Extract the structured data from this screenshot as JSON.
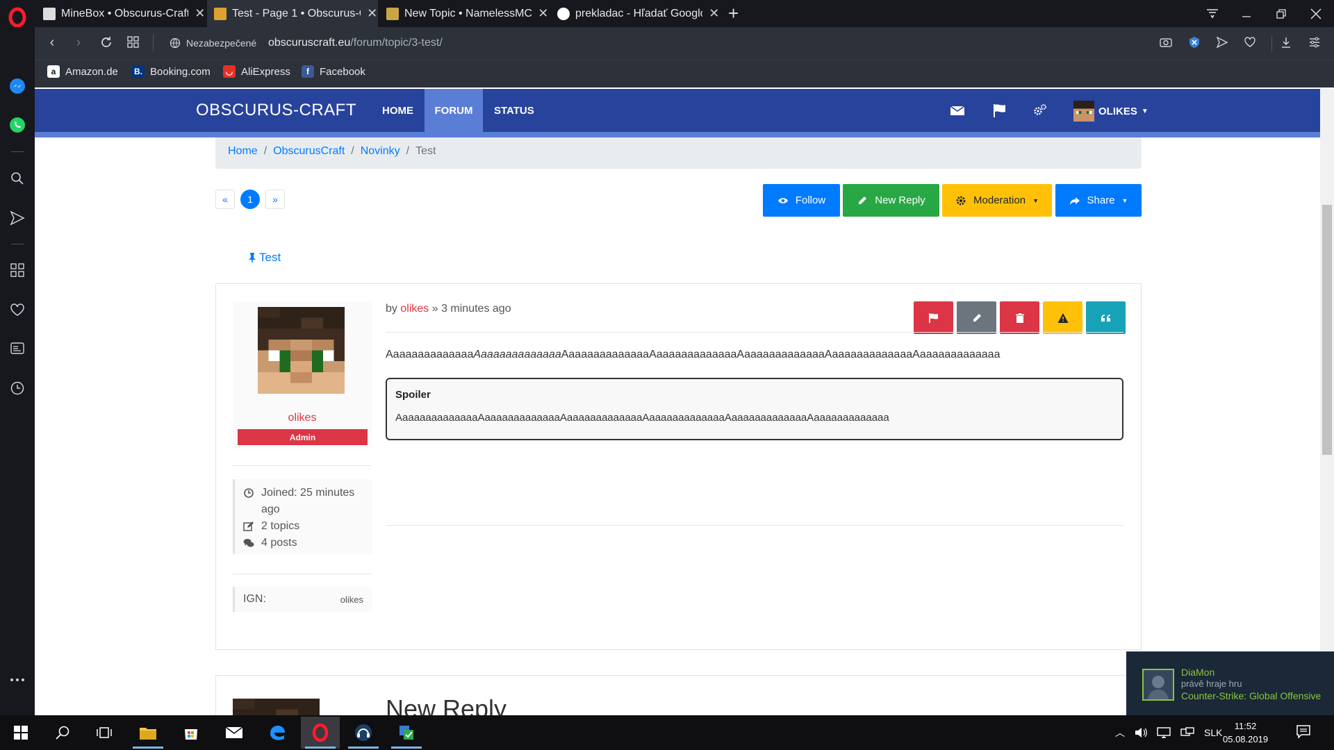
{
  "browser": {
    "tabs": [
      {
        "title": "MineBox • Obscurus-Craft",
        "active": false
      },
      {
        "title": "Test - Page 1 • Obscurus-Craft",
        "active": true
      },
      {
        "title": "New Topic • NamelessMC",
        "active": false
      },
      {
        "title": "prekladac - Hľadať Googlom",
        "active": false
      }
    ],
    "security_label": "Nezabezpečené",
    "url_host": "obscuruscraft.eu",
    "url_path": "/forum/topic/3-test/",
    "bookmarks": [
      {
        "label": "Amazon.de"
      },
      {
        "label": "Booking.com"
      },
      {
        "label": "AliExpress"
      },
      {
        "label": "Facebook"
      }
    ]
  },
  "site": {
    "brand": "OBSCURUS-CRAFT",
    "nav": {
      "home": "HOME",
      "forum": "FORUM",
      "status": "STATUS"
    },
    "user_menu": "OLIKES"
  },
  "breadcrumb": {
    "home": "Home",
    "section": "ObscurusCraft",
    "category": "Novinky",
    "current": "Test"
  },
  "pagination": {
    "prev": "«",
    "current": "1",
    "next": "»"
  },
  "actions": {
    "follow": "Follow",
    "new_reply": "New Reply",
    "moderation": "Moderation",
    "share": "Share"
  },
  "topic": {
    "title": "Test"
  },
  "post": {
    "by": "by",
    "author": "olikes",
    "separator": "»",
    "time": "3 minutes ago",
    "content_a": "Aaaaaaaaaaaaaa",
    "content_b_italic": "Aaaaaaaaaaaaaa",
    "content_c": "AaaaaaaaaaaaaaAaaaaaaaaaaaaaAaaaaaaaaaaaaaAaaaaaaaaaaaaaAaaaaaaaaaaaaa",
    "spoiler_title": "Spoiler",
    "spoiler_body": "AaaaaaaaaaaaaaAaaaaaaaaaaaaaAaaaaaaaaaaaaaAaaaaaaaaaaaaaAaaaaaaaaaaaaaAaaaaaaaaaaaaa"
  },
  "user": {
    "name": "olikes",
    "role": "Admin",
    "joined": "Joined: 25 minutes ago",
    "topics": "2 topics",
    "posts": "4 posts",
    "ign_label": "IGN:",
    "ign_value": "olikes"
  },
  "reply": {
    "title": "New Reply"
  },
  "notification": {
    "name": "DiaMon",
    "action": "právě hraje hru",
    "game": "Counter-Strike: Global Offensive"
  },
  "taskbar": {
    "language": "SLK",
    "time": "11:52",
    "date": "05.08.2019"
  },
  "colors": {
    "navbar": "#28439c",
    "navbar_active": "#5a7ed6",
    "follow": "#007bff",
    "new_reply": "#28a745",
    "moderation": "#ffc107",
    "share": "#007bff",
    "danger": "#dc3545",
    "secondary": "#6c757d",
    "info": "#17a2b8"
  }
}
